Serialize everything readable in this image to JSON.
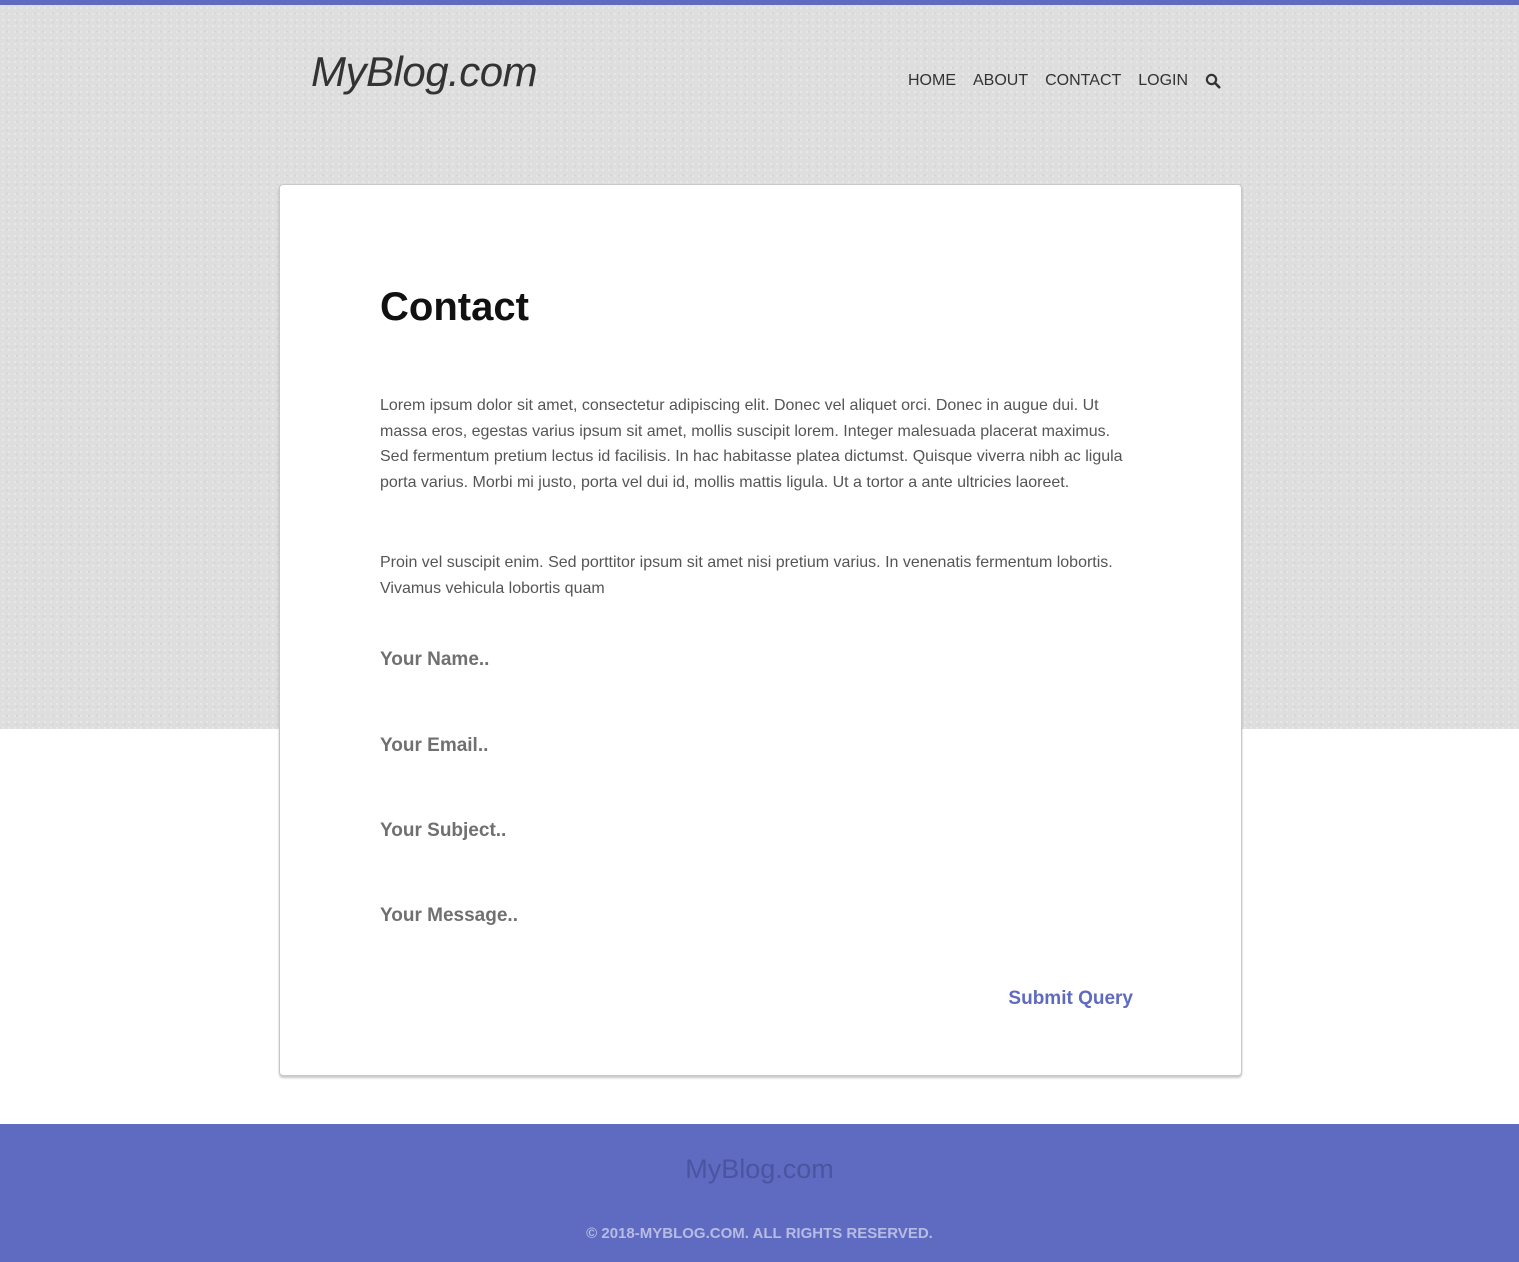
{
  "header": {
    "logo": "MyBlog.com",
    "nav": [
      {
        "label": "HOME"
      },
      {
        "label": "ABOUT"
      },
      {
        "label": "CONTACT"
      },
      {
        "label": "LOGIN"
      }
    ],
    "search_icon": "search-icon"
  },
  "main": {
    "title": "Contact",
    "paragraphs": [
      "Lorem ipsum dolor sit amet, consectetur adipiscing elit. Donec vel aliquet orci. Donec in augue dui. Ut massa eros, egestas varius ipsum sit amet, mollis suscipit lorem. Integer malesuada placerat maximus. Sed fermentum pretium lectus id facilisis. In hac habitasse platea dictumst. Quisque viverra nibh ac ligula porta varius. Morbi mi justo, porta vel dui id, mollis mattis ligula. Ut a tortor a ante ultricies laoreet.",
      "Proin vel suscipit enim. Sed porttitor ipsum sit amet nisi pretium varius. In venenatis fermentum lobortis. Vivamus vehicula lobortis quam"
    ],
    "form": {
      "name_placeholder": "Your Name..",
      "email_placeholder": "Your Email..",
      "subject_placeholder": "Your Subject..",
      "message_placeholder": "Your Message..",
      "submit_label": "Submit Query"
    }
  },
  "footer": {
    "brand": "MyBlog.com",
    "copyright": "© 2018-MYBLOG.COM. ALL RIGHTS RESERVED."
  },
  "colors": {
    "accent": "#5e6bc0",
    "hero_background": "#dedede",
    "footer_text": "#b6bce4"
  }
}
